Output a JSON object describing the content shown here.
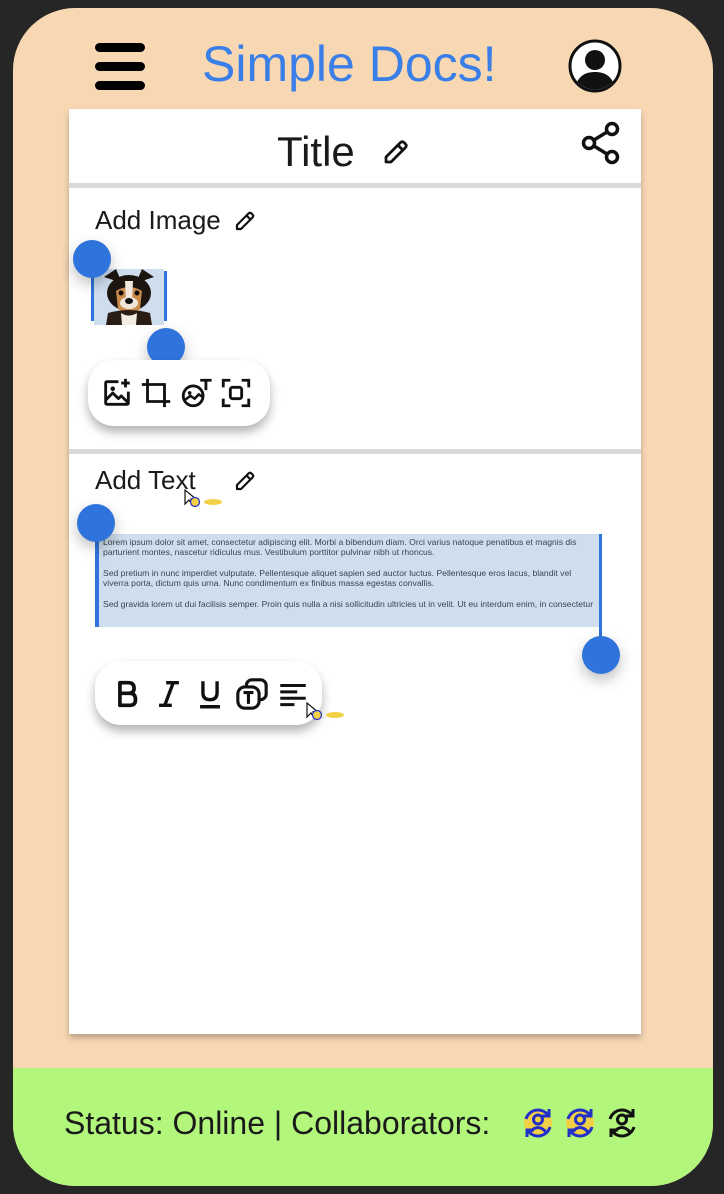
{
  "header": {
    "app_title": "Simple Docs!",
    "menu_icon": "hamburger-menu-icon",
    "profile_icon": "user-avatar-icon"
  },
  "document": {
    "title": "Title",
    "share_icon": "share-icon",
    "image_section": {
      "label": "Add Image",
      "toolbar_icons": [
        "add-image-icon",
        "crop-icon",
        "image-text-icon",
        "focus-frame-icon"
      ]
    },
    "text_section": {
      "label": "Add Text",
      "paragraphs": [
        "Lorem ipsum dolor sit amet, consectetur adipiscing elit. Morbi a bibendum diam. Orci varius natoque penatibus et magnis dis parturient montes, nascetur ridiculus mus. Vestibulum porttitor pulvinar nibh ut rhoncus.",
        "Sed pretium in nunc imperdiet vulputate. Pellentesque aliquet sapien sed auctor luctus. Pellentesque eros lacus, blandit vel viverra porta, dictum quis urna. Nunc condimentum ex finibus massa egestas convallis.",
        "Sed gravida lorem ut dui facilisis semper. Proin quis nulla a nisi sollicitudin ultricies ut in velit. Ut eu interdum enim, in consectetur"
      ],
      "toolbar_icons": [
        "bold-icon",
        "italic-icon",
        "underline-icon",
        "text-style-icon",
        "align-left-icon"
      ]
    }
  },
  "status_bar": {
    "text": "Status: Online | Collaborators:",
    "collaborator_icons": [
      "collaborator-sync-icon",
      "collaborator-sync-icon",
      "collaborator-sync-icon"
    ]
  },
  "colors": {
    "phone_background": "#f8d8b3",
    "title_blue": "#3a7fe8",
    "selection_blue": "#2f74dc",
    "selection_fill": "#cfdeee",
    "status_green": "#b2f67b",
    "collaborator_blue": "#2330c8",
    "cursor_yellow": "#f2d046"
  }
}
